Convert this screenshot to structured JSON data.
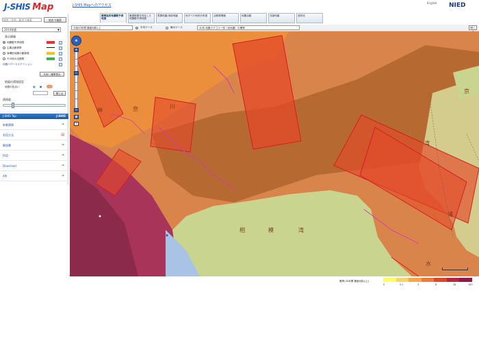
{
  "header": {
    "logo_text": "J-SHIS",
    "logo_map": "Map",
    "top_link": "J-SHIS Mapへのアクセス",
    "lang": "English",
    "nied": "NIED"
  },
  "tabs": [
    {
      "label": "確率論的地震動予測地図",
      "active": true
    },
    {
      "label": "震源断層を特定した地震動予測地図",
      "active": false
    },
    {
      "label": "表層地盤/深部地盤",
      "active": false
    },
    {
      "label": "地すべり地形分布図",
      "active": false
    },
    {
      "label": "活断層情報",
      "active": false
    },
    {
      "label": "地震活動",
      "active": false
    },
    {
      "label": "浅部地盤",
      "active": false
    },
    {
      "label": "液状化",
      "active": false
    }
  ],
  "sidebar": {
    "search_placeholder": "地名・住所・駅名で検索",
    "search_button": "地名で検索",
    "version_select": "2014年版",
    "layer_title": "表示情報",
    "layers": [
      {
        "label": "地震動予測地図",
        "swatch": "#e8322f"
      },
      {
        "label": "主要活断層帯",
        "swatch": "#111111"
      },
      {
        "label": "海溝型地震の震源域",
        "swatch": "#f0c420"
      },
      {
        "label": "その他の活断層",
        "swatch": "#39b54a"
      },
      {
        "label": "地震ハザードステーション",
        "swatch": ""
      }
    ],
    "legend_button": "凡例・確率表示",
    "opacity_title": "地図の透過設定",
    "opacity_label": "地図の色合い",
    "open_button": "閉じる",
    "transparency_label": "透過度"
  },
  "menu": {
    "bar_title": "J-SHIS Top",
    "bar_brand": "J-SHIS",
    "items": [
      {
        "label": "新着情報"
      },
      {
        "label": "利用方法"
      },
      {
        "label": "解説書"
      },
      {
        "label": "FAQ"
      },
      {
        "label": "Download"
      },
      {
        "label": "API"
      }
    ]
  },
  "toolbar": {
    "select1": "今後30年間 震度6弱以上",
    "radio1": "平均ケース",
    "radio2": "最大ケース",
    "select2": "30年 地震カテゴリー別（全地震）の確率",
    "close": "閉じる"
  },
  "map": {
    "labels": {
      "kanagawa_a": "相",
      "kanagawa_b": "模",
      "kanagawa_c": "湾",
      "tokyo_bay": "京",
      "bay_a": "湾",
      "bay_b": "浦",
      "bay_c": "水",
      "kana_1": "神",
      "kana_2": "奈",
      "kana_3": "川"
    }
  },
  "legend": {
    "label": "確率(30年間 震度6弱以上)",
    "colors": [
      "#ffff66",
      "#fdd36a",
      "#f7a64b",
      "#ec7a3a",
      "#d84a2a",
      "#b52a3a",
      "#8c1a4a"
    ],
    "ticks": [
      "0",
      "0.1",
      "3",
      "6",
      "26",
      "100"
    ]
  }
}
